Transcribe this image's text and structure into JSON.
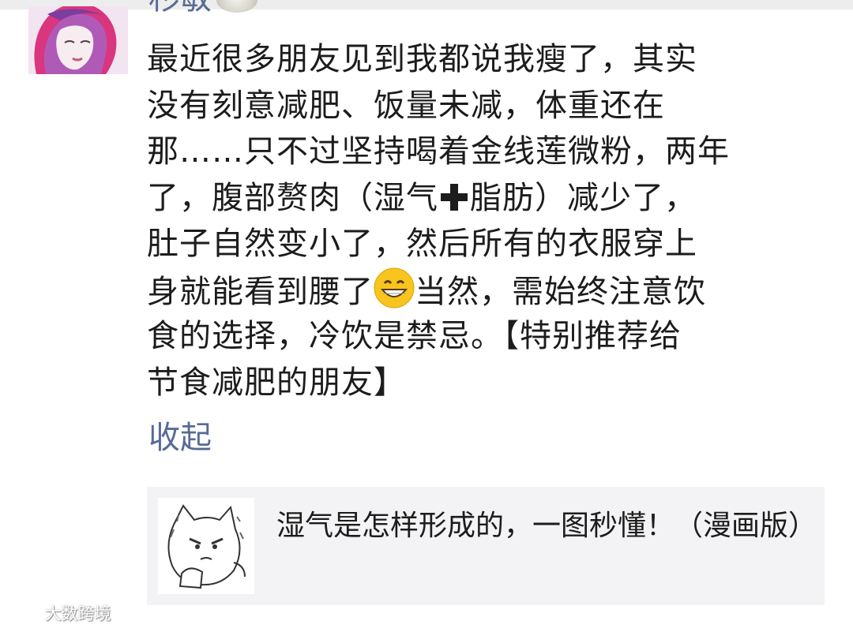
{
  "post": {
    "username": "杉敏",
    "username_emoji": "bowl-emoji",
    "avatar": "avatar-icon",
    "text_lines": [
      "最近很多朋友见到我都说我瘦了，其实",
      "没有刻意减肥、饭量未减，体重还在",
      "那……只不过坚持喝着金线莲微粉，两年",
      {
        "before": "了，腹部赘肉（湿气",
        "icon": "plus-icon",
        "after": "脂肪）减少了，"
      },
      "肚子自然变小了，然后所有的衣服穿上",
      {
        "before": "身就能看到腰了",
        "icon": "grin-emoji",
        "after": "当然，需始终注意饮"
      },
      "食的选择，冷饮是禁忌。【特别推荐给",
      "节食减肥的朋友】"
    ],
    "collapse_label": "收起"
  },
  "link_card": {
    "title": "湿气是怎样形成的，一图秒懂！（漫画版）",
    "thumbnail": "cartoon-thumbnail-icon"
  },
  "watermark": {
    "text": "大数跨境",
    "logo": "watermark-logo-icon"
  },
  "colors": {
    "link": "#576b95",
    "text": "#1c1c1c",
    "card_bg": "#f3f3f5"
  }
}
